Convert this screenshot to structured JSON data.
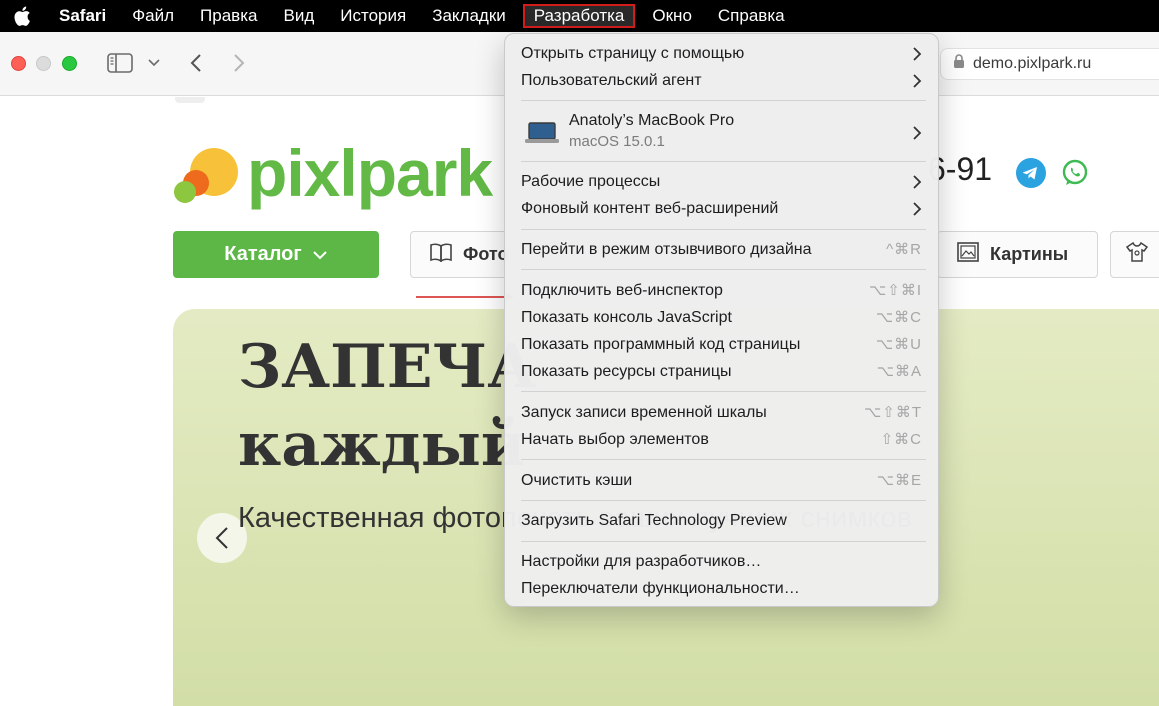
{
  "menubar": {
    "items": [
      "Safari",
      "Файл",
      "Правка",
      "Вид",
      "История",
      "Закладки",
      "Разработка",
      "Окно",
      "Справка"
    ],
    "active_index": 6
  },
  "toolbar": {
    "address": "demo.pixlpark.ru"
  },
  "site": {
    "logo_text": "pixlpark",
    "phone_tail": "6-91",
    "catalog_label": "Каталог",
    "nav": [
      "Фото",
      "Картины"
    ],
    "hero_title_1": "ЗАПЕЧА",
    "hero_title_2": "каждый",
    "hero_subtitle": "Качественная фотопечать ваших лучших снимков",
    "colors": {
      "brand_green": "#5db746",
      "hero_bg": "#dde6b8"
    }
  },
  "dropdown": {
    "open_with": "Открыть страницу с помощью",
    "user_agent": "Пользовательский агент",
    "device_name": "Anatoly’s MacBook Pro",
    "device_os": "macOS 15.0.1",
    "workflows": "Рабочие процессы",
    "bg_content": "Фоновый контент веб-расширений",
    "responsive": "Перейти в режим отзывчивого дизайна",
    "responsive_sc": "^⌘R",
    "inspector": "Подключить веб-инспектор",
    "inspector_sc": "⌥⇧⌘I",
    "js_console": "Показать консоль JavaScript",
    "js_console_sc": "⌥⌘C",
    "source": "Показать программный код страницы",
    "source_sc": "⌥⌘U",
    "resources": "Показать ресурсы страницы",
    "resources_sc": "⌥⌘A",
    "timeline": "Запуск записи временной шкалы",
    "timeline_sc": "⌥⇧⌘T",
    "select_el": "Начать выбор элементов",
    "select_el_sc": "⇧⌘C",
    "clear_cache": "Очистить кэши",
    "clear_cache_sc": "⌥⌘E",
    "stp": "Загрузить Safari Technology Preview",
    "dev_settings": "Настройки для разработчиков…",
    "feature_flags": "Переключатели функциональности…"
  }
}
